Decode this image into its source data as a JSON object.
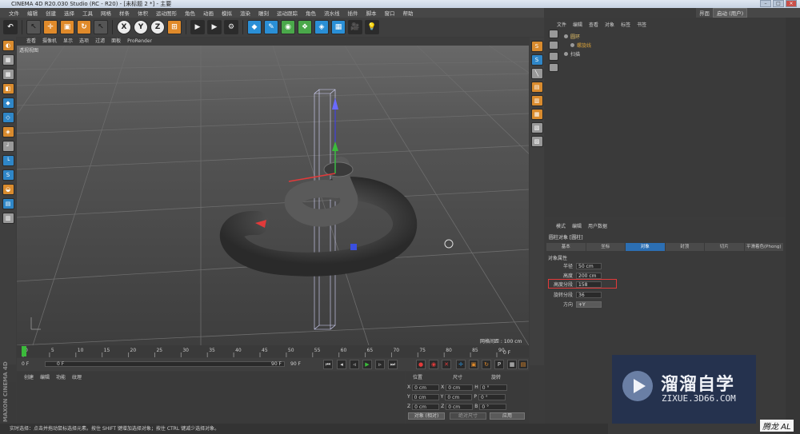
{
  "window": {
    "title": "CINEMA 4D R20.030 Studio (RC - R20) - [未标题 2 *] - 主要"
  },
  "menubar": {
    "items": [
      "文件",
      "编辑",
      "创建",
      "选择",
      "工具",
      "网格",
      "样条",
      "体积",
      "运动图形",
      "角色",
      "动画",
      "模拟",
      "渲染",
      "雕刻",
      "运动跟踪",
      "角色",
      "流水线",
      "插件",
      "脚本",
      "窗口",
      "帮助"
    ]
  },
  "layout": {
    "label": "界面",
    "value": "启动 (用户)"
  },
  "toolbar": {
    "tools": [
      "undo",
      "select-arrow",
      "move",
      "scale",
      "rotate",
      "live-select",
      "X",
      "Y",
      "Z",
      "coordinate",
      "render-view",
      "render-active",
      "render-settings",
      "cube",
      "pen",
      "subdivision",
      "array",
      "deformer",
      "floor",
      "camera",
      "light"
    ]
  },
  "viewport": {
    "menu": [
      "查看",
      "摄像机",
      "显示",
      "选项",
      "过滤",
      "面板",
      "ProRender"
    ],
    "label": "透视视图",
    "scale": "网格间距 : 100 cm"
  },
  "object_manager": {
    "menu": [
      "文件",
      "编辑",
      "查看",
      "对象",
      "标签",
      "书签"
    ],
    "objects": [
      {
        "name": "圆环"
      },
      {
        "name": "螺旋线"
      },
      {
        "name": "扫描"
      }
    ]
  },
  "attributes": {
    "menu": [
      "模式",
      "编辑",
      "用户数据"
    ],
    "title": "圆柱对象 [圆柱]",
    "tabs": [
      "基本",
      "坐标",
      "对象",
      "封顶",
      "切片",
      "平滑着色(Phong)"
    ],
    "active_tab": 2,
    "section": "对象属性",
    "fields": [
      {
        "label": "半径",
        "value": "50 cm"
      },
      {
        "label": "高度",
        "value": "200 cm"
      },
      {
        "label": "高度分段",
        "value": "158"
      },
      {
        "label": "旋转分段",
        "value": "36"
      },
      {
        "label": "方向",
        "value": "+Y"
      }
    ]
  },
  "timeline": {
    "ticks": [
      "0",
      "5",
      "10",
      "15",
      "20",
      "25",
      "30",
      "35",
      "40",
      "45",
      "50",
      "55",
      "60",
      "65",
      "70",
      "75",
      "80",
      "85",
      "90"
    ],
    "current": "0 F",
    "start": "0 F",
    "min": "0 F",
    "max": "90 F",
    "end": "90 F"
  },
  "materials": {
    "menu": [
      "创建",
      "编辑",
      "功能",
      "纹理"
    ]
  },
  "coordinates": {
    "headers": [
      "位置",
      "尺寸",
      "旋转"
    ],
    "rows": [
      {
        "axis": "X",
        "pos": "0 cm",
        "size_axis": "X",
        "size": "0 cm",
        "rot_axis": "H",
        "rot": "0 °"
      },
      {
        "axis": "Y",
        "pos": "0 cm",
        "size_axis": "Y",
        "size": "0 cm",
        "rot_axis": "P",
        "rot": "0 °"
      },
      {
        "axis": "Z",
        "pos": "0 cm",
        "size_axis": "Z",
        "size": "0 cm",
        "rot_axis": "B",
        "rot": "0 °"
      }
    ],
    "mode": "对象 (相对)",
    "size_mode": "绝对尺寸",
    "apply": "应用"
  },
  "status": "实时选择：点击并拖动鼠标选择元素。按住 SHIFT 键增加选择对象；按住 CTRL 键减少选择对象。",
  "brand": "MAXON CINEMA 4D",
  "watermark": {
    "title": "溜溜自学",
    "url": "ZIXUE.3D66.COM"
  },
  "signature": "腾龙 AL",
  "colors": {
    "highlight": "#e23a3a",
    "active_tab": "#2c6fb3",
    "axis_x": "#e23a3a",
    "axis_y": "#3bbb3b",
    "axis_z": "#3a4fe0"
  }
}
